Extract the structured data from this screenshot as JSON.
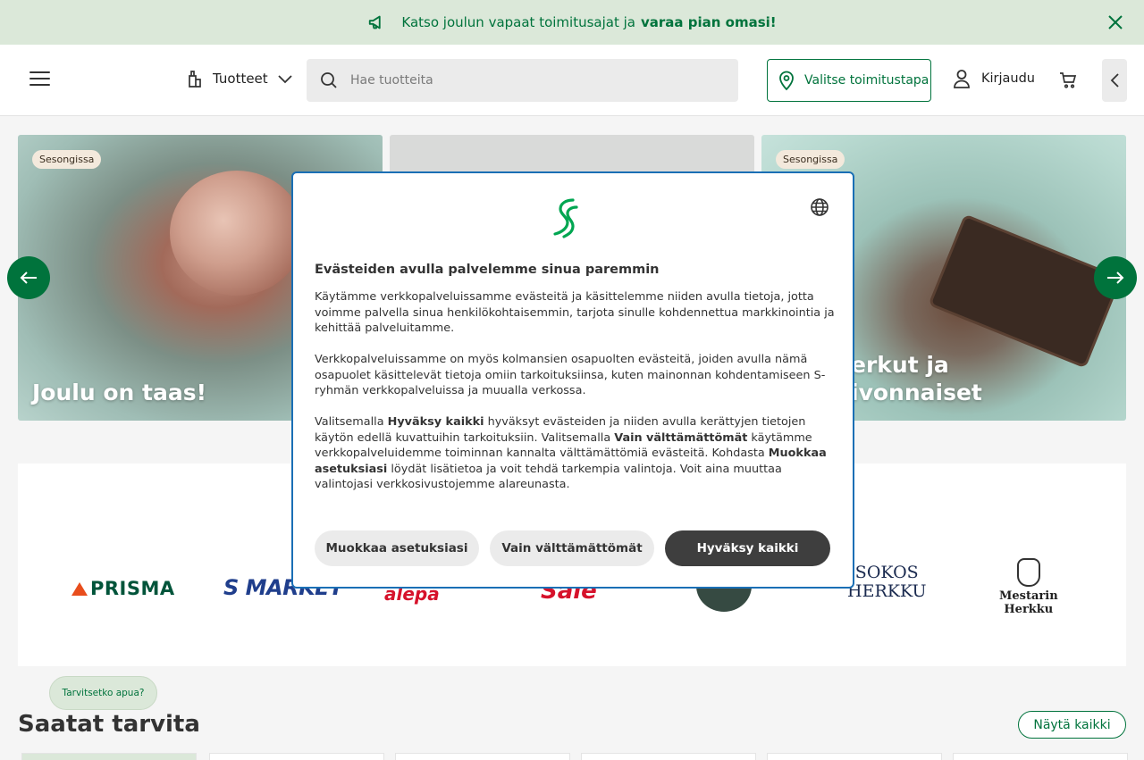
{
  "announcement": {
    "text": "Katso joulun vapaat toimitusajat ja",
    "link": "varaa pian omasi!"
  },
  "header": {
    "products_label": "Tuotteet",
    "search_placeholder": "Hae tuotteita",
    "delivery_label": "Valitse toimitustapa",
    "login_label": "Kirjaudu"
  },
  "carousel": {
    "cards": [
      {
        "badge": "Sesongissa",
        "title": "Joulu on taas!"
      },
      {
        "badge": "",
        "title": ""
      },
      {
        "badge": "Sesongissa",
        "title_line1": "erkut ja",
        "title_line2": "ivonnaiset"
      }
    ]
  },
  "chains": {
    "prisma": "PRISMA",
    "smarket": "S MARKET",
    "alepa": "alepa",
    "sale": "Sale",
    "sokos_line1": "SOKOS",
    "sokos_line2": "HERKKU",
    "mestarin_line1": "Mestarin",
    "mestarin_line2": "Herkku"
  },
  "bottom": {
    "help_label": "Tarvitsetko apua?",
    "section_title": "Saatat tarvita",
    "show_all_label": "Näytä kaikki"
  },
  "cookie_modal": {
    "title": "Evästeiden avulla palvelemme sinua paremmin",
    "p1": "Käytämme verkkopalveluissamme evästeitä ja käsittelemme niiden avulla tietoja, jotta voimme palvella sinua henkilökohtaisemmin, tarjota sinulle kohdennettua markkinointia ja kehittää palveluitamme.",
    "p2": "Verkkopalveluissamme on myös kolmansien osapuolten evästeitä, joiden avulla nämä osapuolet käsittelevät tietoja omiin tarkoituksiinsa, kuten mainonnan kohdentamiseen S-ryhmän verkkopalveluissa ja muualla verkossa.",
    "p3_a": "Valitsemalla ",
    "p3_b1": "Hyväksy kaikki",
    "p3_c": " hyväksyt evästeiden ja niiden avulla kerättyjen tietojen käytön edellä kuvattuihin tarkoituksiin. Valitsemalla ",
    "p3_b2": "Vain välttämättömät",
    "p3_d": " käytämme verkkopalveluidemme toiminnan kannalta välttämättömiä evästeitä. Kohdasta ",
    "p3_b3": "Muokkaa asetuksiasi",
    "p3_e": " löydät lisätietoa ja voit tehdä tarkempia valintoja. Voit aina muuttaa valintojasi verkkosivustojemme alareunasta.",
    "btn_edit": "Muokkaa asetuksiasi",
    "btn_necessary": "Vain välttämättömät",
    "btn_accept": "Hyväksy kaikki"
  },
  "colors": {
    "brand_green": "#00733c",
    "announcement_bg": "#dbe8d9",
    "modal_border": "#1a6fb5",
    "accept_button": "#3e3e3e"
  }
}
